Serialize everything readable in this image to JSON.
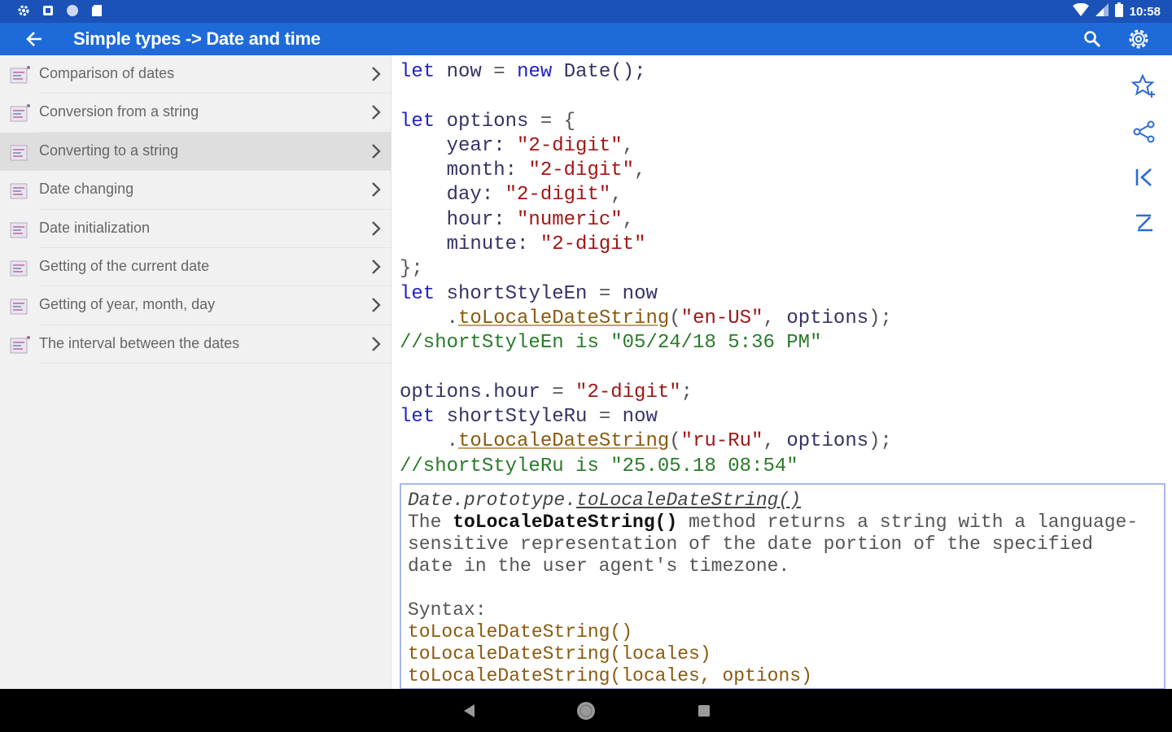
{
  "status_bar": {
    "time": "10:58",
    "left_icons": [
      "settings-icon",
      "notification-icon",
      "circle-icon",
      "sd-card-icon"
    ],
    "right_icons": [
      "wifi-icon",
      "signal-icon",
      "battery-icon"
    ]
  },
  "app_bar": {
    "title": "Simple types -> Date and time",
    "back_icon": "arrow-left-icon",
    "search_icon": "search-icon",
    "settings_icon": "gear-icon",
    "color": "#1e6ad8"
  },
  "sidebar": {
    "items": [
      {
        "label": "Comparison of dates",
        "selected": false,
        "badge": true
      },
      {
        "label": "Conversion from a string",
        "selected": false,
        "badge": true
      },
      {
        "label": "Converting to a string",
        "selected": true,
        "badge": false
      },
      {
        "label": "Date changing",
        "selected": false,
        "badge": false
      },
      {
        "label": "Date initialization",
        "selected": false,
        "badge": false
      },
      {
        "label": "Getting of the current date",
        "selected": false,
        "badge": false
      },
      {
        "label": "Getting of year, month, day",
        "selected": false,
        "badge": false
      },
      {
        "label": "The interval between the dates",
        "selected": false,
        "badge": true
      }
    ]
  },
  "code": {
    "kw_let": "let",
    "kw_new": "new",
    "now": "now",
    "date_ctor": "Date();",
    "options": "options",
    "year": "year:",
    "month": "month:",
    "day": "day:",
    "hour": "hour:",
    "minute": "minute:",
    "two_digit": "\"2-digit\"",
    "numeric": "\"numeric\"",
    "short_en": "shortStyleEn",
    "short_ru": "shortStyleRu",
    "method": "toLocaleDateString",
    "locale_en": "\"en-US\"",
    "locale_ru": "\"ru-Ru\"",
    "comment_en": "//shortStyleEn is \"05/24/18 5:36 PM\"",
    "comment_ru": "//shortStyleRu is \"25.05.18 08:54\"",
    "options_hour": "options.hour"
  },
  "doc": {
    "signature_prefix": "Date.prototype.",
    "signature_method": "toLocaleDateString()",
    "desc_pre": "The ",
    "desc_bold": "toLocaleDateString()",
    "desc_line1_rest": " method returns a string with a language-",
    "desc_line2": "sensitive representation of the date portion of the specified",
    "desc_line3": "date in the user agent's timezone.",
    "syntax_label": "Syntax:",
    "syntax_1": "toLocaleDateString()",
    "syntax_2": "toLocaleDateString(locales)",
    "syntax_3": "toLocaleDateString(locales, options)"
  },
  "action_rail": [
    "star-plus-icon",
    "share-icon",
    "first-page-icon",
    "last-page-icon"
  ],
  "nav_bar": [
    "back-triangle-icon",
    "home-circle-icon",
    "recents-square-icon"
  ]
}
